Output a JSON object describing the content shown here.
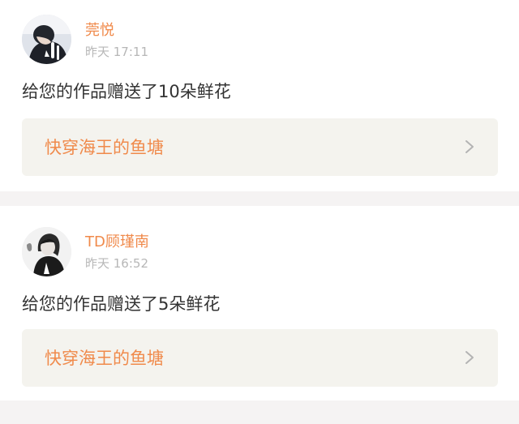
{
  "notifications": [
    {
      "username": "莞悦",
      "timestamp": "昨天 17:11",
      "message": "给您的作品赠送了10朵鲜花",
      "work_title": "快穿海王的鱼塘"
    },
    {
      "username": "TD顾瑾南",
      "timestamp": "昨天 16:52",
      "message": "给您的作品赠送了5朵鲜花",
      "work_title": "快穿海王的鱼塘"
    }
  ],
  "colors": {
    "accent": "#f08a4b",
    "card_bg": "#ffffff",
    "link_bg": "#f4f3ee",
    "divider": "#f5f3f3",
    "text": "#333333",
    "muted": "#b7b7b7"
  },
  "icons": {
    "chevron": "chevron-right-icon"
  }
}
